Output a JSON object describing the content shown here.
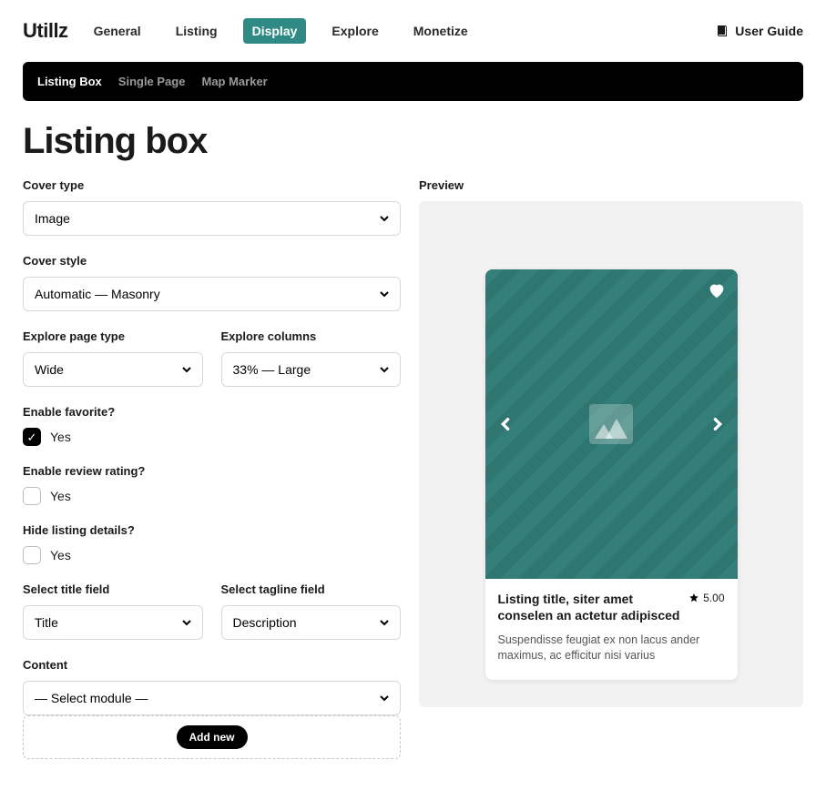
{
  "brand": "Utillz",
  "topnav": {
    "items": [
      "General",
      "Listing",
      "Display",
      "Explore",
      "Monetize"
    ],
    "active": 2
  },
  "userguide_label": "User Guide",
  "subnav": {
    "items": [
      "Listing Box",
      "Single Page",
      "Map Marker"
    ],
    "active": 0
  },
  "page_title": "Listing box",
  "fields": {
    "cover_type": {
      "label": "Cover type",
      "value": "Image"
    },
    "cover_style": {
      "label": "Cover style",
      "value": "Automatic — Masonry"
    },
    "explore_page_type": {
      "label": "Explore page type",
      "value": "Wide"
    },
    "explore_columns": {
      "label": "Explore columns",
      "value": "33% — Large"
    },
    "enable_favorite": {
      "label": "Enable favorite?",
      "option": "Yes",
      "checked": true
    },
    "enable_review": {
      "label": "Enable review rating?",
      "option": "Yes",
      "checked": false
    },
    "hide_details": {
      "label": "Hide listing details?",
      "option": "Yes",
      "checked": false
    },
    "select_title": {
      "label": "Select title field",
      "value": "Title"
    },
    "select_tagline": {
      "label": "Select tagline field",
      "value": "Description"
    },
    "content": {
      "label": "Content",
      "value": "— Select module —",
      "add_label": "Add new"
    }
  },
  "preview": {
    "label": "Preview",
    "card_title": "Listing title, siter amet conselen an actetur adipisced",
    "rating": "5.00",
    "desc": "Suspendisse feugiat ex non lacus ander maximus, ac efficitur nisi varius"
  },
  "colors": {
    "accent": "#2f8a85"
  }
}
